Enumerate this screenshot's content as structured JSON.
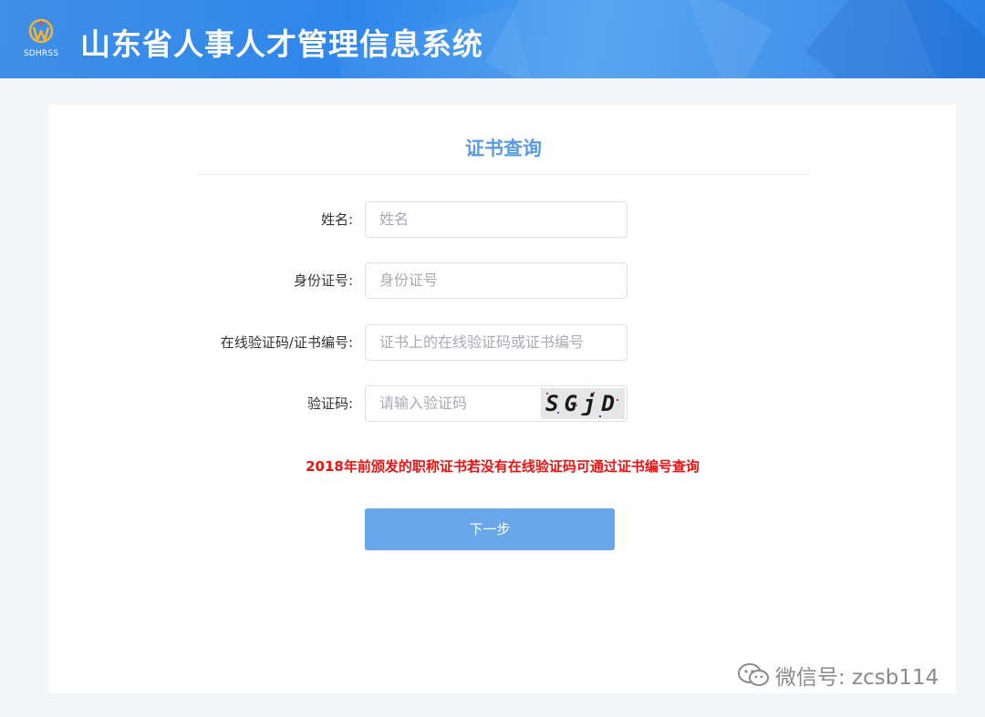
{
  "header": {
    "logo_text": "SDHRSS",
    "title": "山东省人事人才管理信息系统"
  },
  "form": {
    "title": "证书查询",
    "fields": [
      {
        "label": "姓名:",
        "placeholder": "姓名"
      },
      {
        "label": "身份证号:",
        "placeholder": "身份证号"
      },
      {
        "label": "在线验证码/证书编号:",
        "placeholder": "证书上的在线验证码或证书编号"
      },
      {
        "label": "验证码:",
        "placeholder": "请输入验证码"
      }
    ],
    "captcha_text": "SGjD",
    "notice": "2018年前颁发的职称证书若没有在线验证码可通过证书编号查询",
    "next_button": "下一步"
  },
  "watermark": {
    "icon": "wechat-icon",
    "text": "微信号: zcsb114"
  },
  "colors": {
    "header": "#2f86ea",
    "title": "#5b9ae6",
    "notice": "#ee1111",
    "button": "#6aa6ea"
  }
}
